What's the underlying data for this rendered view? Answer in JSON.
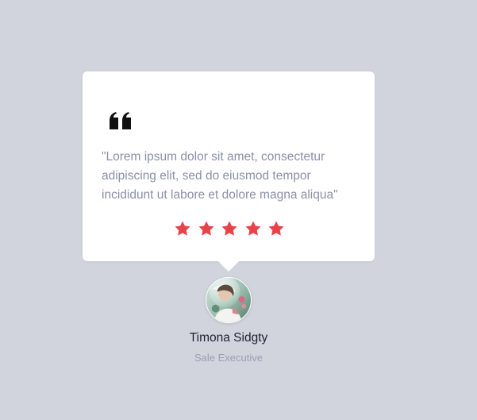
{
  "testimonial": {
    "quote_icon": "quote-icon",
    "text": "\"Lorem ipsum dolor sit amet, consectetur adipiscing elit, sed do eiusmod tempor incididunt ut labore et dolore magna aliqua\"",
    "rating": 5,
    "star_color": "#e8434a",
    "star_icon": "star-icon"
  },
  "author": {
    "avatar": "avatar",
    "name": "Timona Sidgty",
    "role": "Sale Executive"
  },
  "colors": {
    "background": "#d1d4dd",
    "card": "#ffffff",
    "text_muted": "#8a90a8",
    "accent": "#e8434a"
  }
}
